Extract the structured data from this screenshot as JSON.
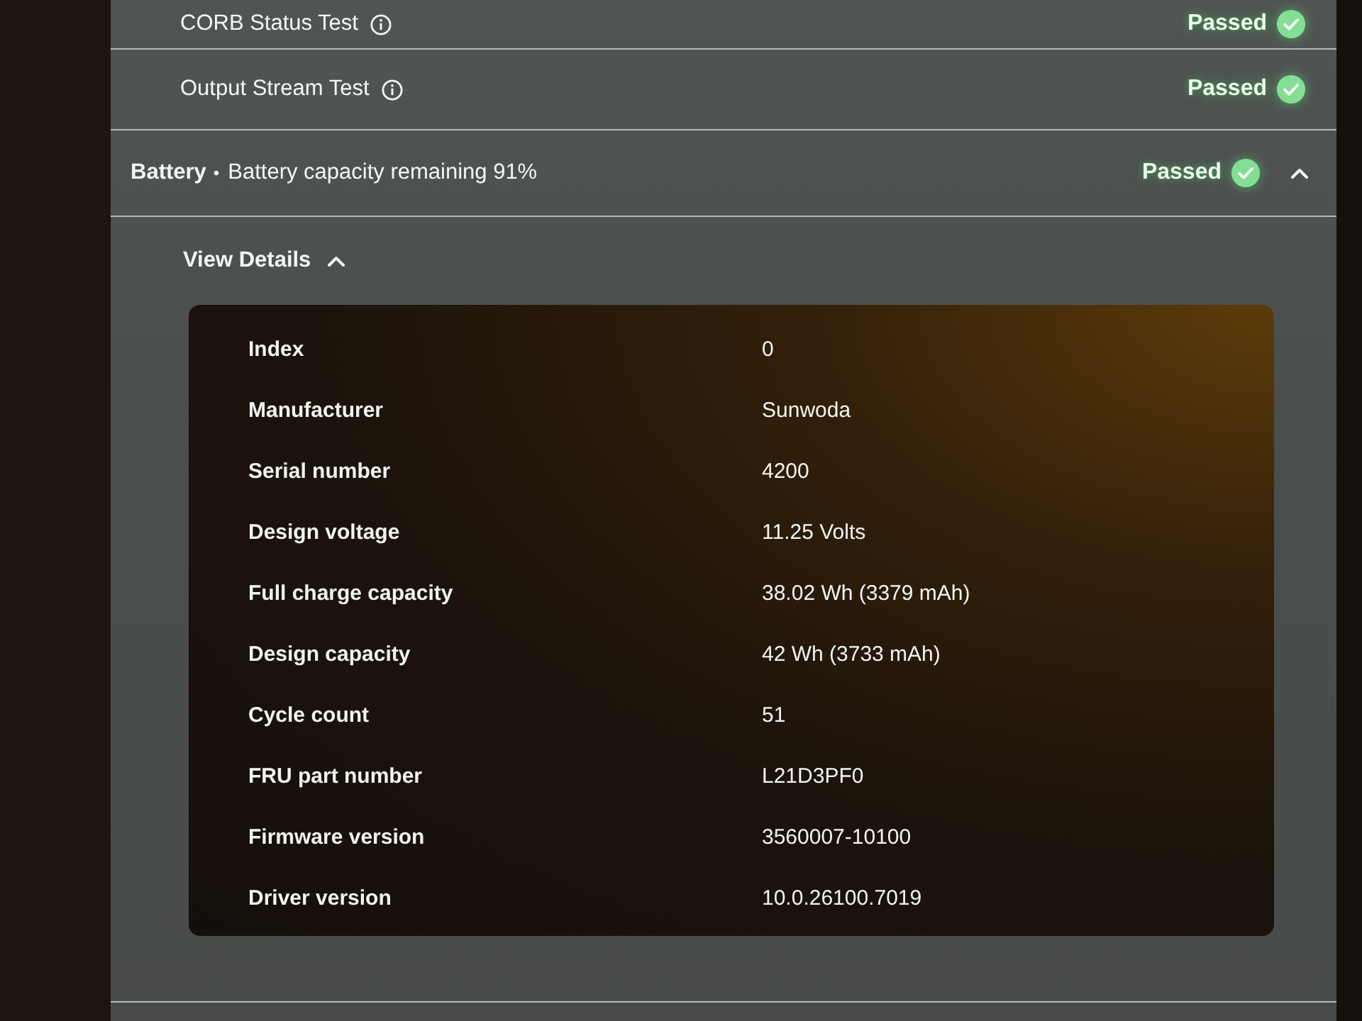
{
  "tests": [
    {
      "name": "CORB Status Test",
      "info_icon": true,
      "status": "Passed"
    },
    {
      "name": "Output Stream Test",
      "info_icon": true,
      "status": "Passed"
    }
  ],
  "battery": {
    "title": "Battery",
    "separator": "•",
    "summary": "Battery capacity remaining 91%",
    "status": "Passed",
    "expanded": true,
    "details_toggle": {
      "label": "View Details",
      "expanded": true
    },
    "details": [
      {
        "label": "Index",
        "value": "0"
      },
      {
        "label": "Manufacturer",
        "value": "Sunwoda"
      },
      {
        "label": "Serial number",
        "value": "4200"
      },
      {
        "label": "Design voltage",
        "value": "11.25 Volts"
      },
      {
        "label": "Full charge capacity",
        "value": "38.02 Wh (3379 mAh)"
      },
      {
        "label": "Design capacity",
        "value": "42 Wh (3733 mAh)"
      },
      {
        "label": "Cycle count",
        "value": "51"
      },
      {
        "label": "FRU part number",
        "value": "L21D3PF0"
      },
      {
        "label": "Firmware version",
        "value": "3560007-10100"
      },
      {
        "label": "Driver version",
        "value": "10.0.26100.7019"
      }
    ]
  }
}
